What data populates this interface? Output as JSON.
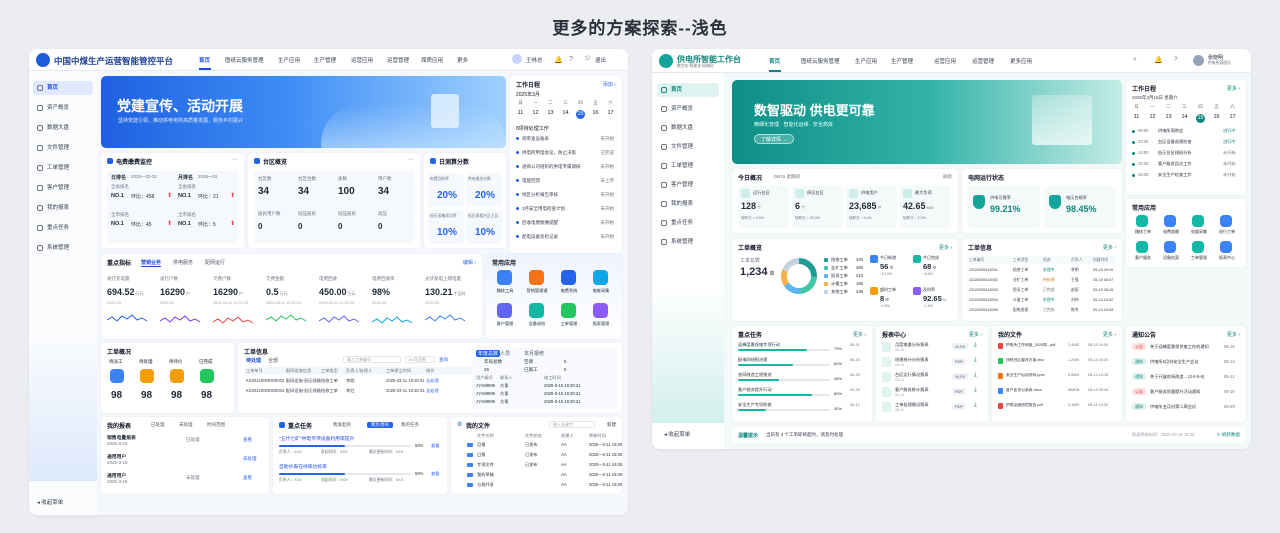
{
  "page_title": "更多的方案探索--浅色",
  "colors": {
    "accent_blue": "#2f6bff",
    "accent_teal": "#17a2a0",
    "red": "#ef4444",
    "orange": "#f59e0b",
    "green": "#22c55e"
  },
  "left": {
    "brand": "中国中煤生产运营智能管控平台",
    "nav": [
      "首页",
      "图纸云服务管理",
      "生产应用",
      "生产管理",
      "运营应用",
      "运营管理",
      "煤质应用",
      "更多"
    ],
    "user": "王林总",
    "logout": "退出",
    "sidebar": [
      "首页",
      "资产概览",
      "数据大盘",
      "文件管理",
      "工单管理",
      "客户管理",
      "我的报表",
      "重点任务",
      "系统管理"
    ],
    "collapse": "收起菜单",
    "banner": {
      "title": "党建宣传、活动开展",
      "subtitle": "坚持党建引领，推动供电电所高质量发展，服务乡村振兴"
    },
    "calendar": {
      "title": "工作日程",
      "add": "添加",
      "month": "2025年3月",
      "weekdays": [
        "日",
        "一",
        "二",
        "三",
        "四",
        "五",
        "六"
      ],
      "days": [
        "11",
        "12",
        "13",
        "14",
        "15",
        "16",
        "17"
      ],
      "section": "8项待处理工作",
      "todos": [
        {
          "text": "调审查设备表",
          "status": "未开始"
        },
        {
          "text": "供电所用电会议，防止决策",
          "status": "已完成"
        },
        {
          "text": "涵商公司组织的供电专属调研",
          "status": "未开始"
        },
        {
          "text": "电能回馈",
          "status": "未上传"
        },
        {
          "text": "地区分析报告审核",
          "status": "未开始"
        },
        {
          "text": "3月安全用电检查计划",
          "status": "未开始"
        },
        {
          "text": "后收电费催缴提醒",
          "status": "未开始"
        },
        {
          "text": "配电设备巡检记录",
          "status": "未开始"
        }
      ]
    },
    "fee_monitor": {
      "title": "电费缴费监控",
      "day_rank": "日排名",
      "day_date": "2025—03-31",
      "month_rank": "月排名",
      "month_date": "2025—02",
      "rows": [
        {
          "label": "全省排名",
          "no": "NO.1",
          "cmp": "环比：458",
          "mlabel": "全省排名",
          "mno": "NO.1",
          "mcmp": "环比：21"
        },
        {
          "label": "全市排名",
          "no": "NO.1",
          "cmp": "环比：45",
          "mlabel": "全市排名",
          "mno": "NO.1",
          "mcmp": "环比：5"
        }
      ]
    },
    "area": {
      "title": "台区概览",
      "top_labels": [
        "台区数",
        "台区台数",
        "表数",
        "用户数"
      ],
      "top_values": [
        "34",
        "34",
        "100",
        "34"
      ],
      "bot_labels": [
        "居民用户数",
        "低压居民",
        "低压居民",
        "高压"
      ],
      "bot_values": [
        "0",
        "0",
        "0",
        "0"
      ]
    },
    "daily": {
      "title": "日测算分数",
      "labels": [
        "电费回收率",
        "供电服务分数",
        "低压采集成功率",
        "低压两相台区占比"
      ],
      "values": [
        "20%",
        "20%",
        "10%",
        "10%"
      ]
    },
    "kpi": {
      "title": "重点指标",
      "more": "编辑",
      "tabs": [
        "营销业务",
        "供电服务",
        "配网运行"
      ],
      "items": [
        {
          "label": "发行充电量",
          "value": "694.52",
          "unit": "万元",
          "date": "2025-03"
        },
        {
          "label": "发行户数",
          "value": "16290",
          "unit": "户",
          "date": "2025-03"
        },
        {
          "label": "欠费户数",
          "value": "16290",
          "unit": "户",
          "date": "2025-03-11 12:22:23"
        },
        {
          "label": "欠费金额",
          "value": "0.5",
          "unit": "万元",
          "date": "2025-03-11 12:22:23"
        },
        {
          "label": "电费回收",
          "value": "450.00",
          "unit": "万元",
          "date": "2025-03-11 12:22:23"
        },
        {
          "label": "电费回收率",
          "value": "98%",
          "unit": "",
          "date": "2025-03"
        },
        {
          "label": "光伏发电上网电量",
          "value": "130.21",
          "unit": "千瓦时",
          "date": "2025-03"
        }
      ]
    },
    "apps": {
      "title": "常用应用",
      "items": [
        "稽核工具",
        "营销管理通",
        "电费系统",
        "电能采集",
        "客户管理",
        "设备巡检",
        "工单管理",
        "报表管理"
      ]
    },
    "workorder": {
      "title": "工单概况",
      "labels": [
        "待派工",
        "待处理",
        "待评价",
        "已完成"
      ],
      "values": [
        "98",
        "98",
        "98",
        "98"
      ]
    },
    "workinfo": {
      "title": "工单信息",
      "search": "输入工单编号",
      "search2": "80月范围",
      "query": "查询",
      "tabs": [
        "待处理",
        "全部"
      ],
      "headers": [
        "工单单号",
        "配网设施信息",
        "工单类型",
        "负责人/处理人",
        "工单建立时间",
        "操作"
      ],
      "rows": [
        [
          "KS20210009300033",
          "配网设施-低压线路",
          "抢修工单",
          "李刚",
          "2025-03-11 19:30:31",
          "去处理"
        ],
        [
          "KS20210009300034",
          "配网设施-低压线路",
          "抢修工单",
          "李红",
          "2025-03-11 19:30:31",
          "去处理"
        ]
      ],
      "side_tabs": [
        "年度总数",
        "人员",
        "本月报修"
      ],
      "side_headers": [
        "年局总数",
        "空调",
        "5"
      ],
      "side_cols": [
        "用户编号",
        "联系人",
        "施工时间"
      ],
      "side_top": [
        "26",
        "已施工",
        "5"
      ],
      "side_rows": [
        [
          "JYA89999",
          "方青",
          "2025-3-15 19:30:31"
        ],
        [
          "JYA89999",
          "方青",
          "2025-3-15 19:30:31"
        ],
        [
          "JYA89999",
          "方青",
          "2025-3-15 19:30:31"
        ]
      ]
    },
    "reports": {
      "title": "我的报表",
      "filters": [
        "已处理",
        "未处理",
        "时间范围"
      ],
      "rows": [
        {
          "name": "销售电量报表",
          "date": "2025-3-15",
          "status": "已处理",
          "action": "查看"
        },
        {
          "name": "通用用户",
          "date": "2025-3-15",
          "status": "",
          "action": "去处理"
        },
        {
          "name": "通用用户",
          "date": "2025-3-15",
          "status": "未处理",
          "action": "查看"
        }
      ]
    },
    "tasks": {
      "title": "重点任务",
      "tabs": [
        "我发起的",
        "我负责的",
        "我的任务"
      ],
      "items": [
        {
          "name": "\"五代七矿\"供电专项设备利用率提升",
          "pct": "50%",
          "pct_num": 50,
          "action": "查看",
          "meta": "负责人：XXX",
          "meta2": "发起时间：XXX",
          "meta3": "最近更新时间：XXX"
        },
        {
          "name": "自助炒表在线率达标率",
          "pct": "50%",
          "pct_num": 50,
          "action": "查看",
          "meta": "负责人：XXX",
          "meta2": "发起时间：XXX",
          "meta3": "最近更新时间：XXX"
        }
      ]
    },
    "files": {
      "title": "我的文件",
      "search": "输入关键字",
      "new": "新建",
      "headers": [
        "文件名称",
        "文件状态",
        "创建人",
        "更新时间"
      ],
      "rows": [
        [
          "月报",
          "已发布",
          "AA",
          "2025—3-11 19:30:31"
        ],
        [
          "日报",
          "已发布",
          "AA",
          "2025—3-11 19:30:31"
        ],
        [
          "专项文件",
          "已发布",
          "AA",
          "2025—3-11 19:30:31"
        ],
        [
          "我的草稿",
          "",
          "AA",
          "2025—3-11 19:30:31"
        ],
        [
          "与我共享",
          "",
          "AA",
          "2025—3-11 19:30:31"
        ]
      ]
    }
  },
  "right": {
    "brand": "供电所智能工作台",
    "brand_sub": "数字化·智能化·网格化",
    "nav": [
      "首页",
      "图纸云服务管理",
      "生产应用",
      "生产管理",
      "运营应用",
      "运营管理",
      "更多应用"
    ],
    "user": "张晓明",
    "user_sub": "供电所管理员",
    "sidebar": [
      "首页",
      "资产概览",
      "数据大盘",
      "文件管理",
      "工单管理",
      "客户管理",
      "我的报表",
      "重点任务",
      "系统管理"
    ],
    "collapse": "收起菜单",
    "banner": {
      "title": "数智驱动  供电更可靠",
      "subtitle": "精细化管理 · 智能化运维 · 安全高效",
      "button": "了解详情"
    },
    "calendar": {
      "title": "工作日程",
      "more": "更多",
      "month": "2025年3月15日 星期六",
      "weekdays": [
        "日",
        "一",
        "二",
        "三",
        "四",
        "五",
        "六"
      ],
      "days": [
        "11",
        "12",
        "13",
        "14",
        "15",
        "16",
        "17"
      ],
      "items": [
        {
          "time": "09:00",
          "text": "供电所周例会",
          "status": "进行中"
        },
        {
          "time": "10:30",
          "text": "台区设备巡视检查",
          "status": "进行中"
        },
        {
          "time": "14:00",
          "text": "低压台区线损分析",
          "status": "未开始"
        },
        {
          "time": "15:30",
          "text": "客户服务回访工作",
          "status": "未开始"
        },
        {
          "time": "16:30",
          "text": "安全生产检查工作",
          "status": "未开始"
        }
      ]
    },
    "today": {
      "title": "今日概况",
      "date": "05/15",
      "date2": "星期四",
      "refresh": "刷新",
      "labels": [
        "运行台区",
        "停运台区",
        "供电用户",
        "最大负荷"
      ],
      "values": [
        "128",
        "6",
        "23,685",
        "42.65"
      ],
      "units": [
        "个",
        "个",
        "户",
        "MW"
      ],
      "trends": [
        "较昨日 ↑ 0.5%",
        "较昨日 ↓ 25.3%",
        "较昨日 ↑ 0.4%",
        "较昨日 ↑ 2.3%"
      ]
    },
    "grid": {
      "title": "电网运行状态",
      "labels": [
        "供电可靠率",
        "电压合格率"
      ],
      "values": [
        "99.21%",
        "98.45%"
      ]
    },
    "apps": {
      "title": "常用应用",
      "items": [
        "稽核工单",
        "电费收缴",
        "电量采集",
        "巡行工单",
        "客户服务",
        "设备档案",
        "工单管理",
        "报表中心"
      ]
    },
    "work": {
      "title": "工单概览",
      "more": "更多",
      "total_label": "工单总数",
      "total": "1,234",
      "total_unit": "单",
      "legend": [
        {
          "label": "抢修工单",
          "value": "320"
        },
        {
          "label": "业扩工单",
          "value": "280"
        },
        {
          "label": "投诉工单",
          "value": "210"
        },
        {
          "label": "计量工单",
          "value": "186"
        },
        {
          "label": "其他工单",
          "value": "238"
        }
      ],
      "donut": [
        320,
        280,
        210,
        186,
        238
      ],
      "donut_colors": [
        "#1f9d94",
        "#3ec8a8",
        "#5fb3f3",
        "#f6b24a",
        "#c7d2e0"
      ],
      "stats": [
        {
          "label": "今日新增",
          "value": "56",
          "unit": "单",
          "trend": "↑12.3%"
        },
        {
          "label": "今日完成",
          "value": "68",
          "unit": "单",
          "trend": "↑8.3%"
        },
        {
          "label": "超时工单",
          "value": "8",
          "unit": "单",
          "trend": "↓2.8%"
        },
        {
          "label": "及时率",
          "value": "92.65",
          "unit": "%",
          "trend": "↑1.2%"
        }
      ]
    },
    "workinfo": {
      "title": "工单信息",
      "more": "更多",
      "headers": [
        "工单编号",
        "工单类型",
        "状态",
        "负责人",
        "创建时间"
      ],
      "rows": [
        [
          "GD20250515001",
          "抢修工单",
          "处理中",
          "李明",
          "05-15 09:20"
        ],
        [
          "GD20250515002",
          "业扩工单",
          "待处理",
          "王强",
          "05-15 08:47"
        ],
        [
          "GD20250515003",
          "投诉工单",
          "已完成",
          "赵丽",
          "05-15 08:15"
        ],
        [
          "GD20250515004",
          "计量工单",
          "处理中",
          "刘伟",
          "05-14 16:32"
        ],
        [
          "GD20250515005",
          "配电巡视",
          "已完成",
          "陈杰",
          "05-14 15:08"
        ]
      ]
    },
    "tasks": {
      "title": "重点任务",
      "more": "更多",
      "items": [
        {
          "name": "迎峰度夏保电专项行动",
          "pct": "75%",
          "pct_num": 75,
          "date": "05-31"
        },
        {
          "name": "配电网线损治理",
          "pct": "60%",
          "pct_num": 60,
          "date": "06-15"
        },
        {
          "name": "农网改造工程推进",
          "pct": "45%",
          "pct_num": 45,
          "date": "06-30"
        },
        {
          "name": "客户服务提升行动",
          "pct": "80%",
          "pct_num": 80,
          "date": "05-25"
        },
        {
          "name": "安全生产专项检查",
          "pct": "30%",
          "pct_num": 30,
          "date": "06-10"
        }
      ]
    },
    "reports": {
      "title": "报表中心",
      "more": "更多",
      "items": [
        {
          "name": "月度电量分析报表",
          "date": "05-15",
          "fmt": "XLSX"
        },
        {
          "name": "线损统计分析报表",
          "date": "05-14",
          "fmt": "PDF"
        },
        {
          "name": "台区运行情况报表",
          "date": "05-13",
          "fmt": "XLSX"
        },
        {
          "name": "客户服务统计报表",
          "date": "05-12",
          "fmt": "PDF"
        },
        {
          "name": "工单处理情况报表",
          "date": "05-11",
          "fmt": "PDF"
        }
      ]
    },
    "files": {
      "title": "我的文件",
      "more": "更多",
      "rows": [
        [
          "供电所工作周报_2025第...pdf",
          "2.4MB",
          "05-15 10:30"
        ],
        [
          "线损台区整改方案.xlsx",
          "1.2MB",
          "05-14 16:20"
        ],
        [
          "安全生产培训资料.pptx",
          "5.6MB",
          "05-13 14:15"
        ],
        [
          "客户走访记录表.docx",
          "856KB",
          "05-12 09:40"
        ],
        [
          "供电设施巡检报告.pdf",
          "3.1MB",
          "05-11 15:30"
        ]
      ]
    },
    "notices": {
      "title": "通知公告",
      "more": "更多",
      "rows": [
        {
          "tag": "公告",
          "text": "关于迎峰度夏保供电工作的通知",
          "date": "05-15"
        },
        {
          "tag": "通知",
          "text": "供电所5月份安全生产会议",
          "date": "05-14"
        },
        {
          "tag": "通知",
          "text": "关于开展农网改造... (3-4-5-6)",
          "date": "05-12"
        },
        {
          "tag": "公告",
          "text": "客户服务质量提升活动通知",
          "date": "05-10"
        },
        {
          "tag": "通知",
          "text": "供电所五月份第二周会议",
          "date": "05-09"
        }
      ]
    },
    "footer": {
      "tag": "温馨提示",
      "text": "当前有 3 个工单即将超时，请及时处理",
      "time": "数据更新时间：2025-05-15 10:30",
      "refresh": "刷新数据"
    }
  }
}
